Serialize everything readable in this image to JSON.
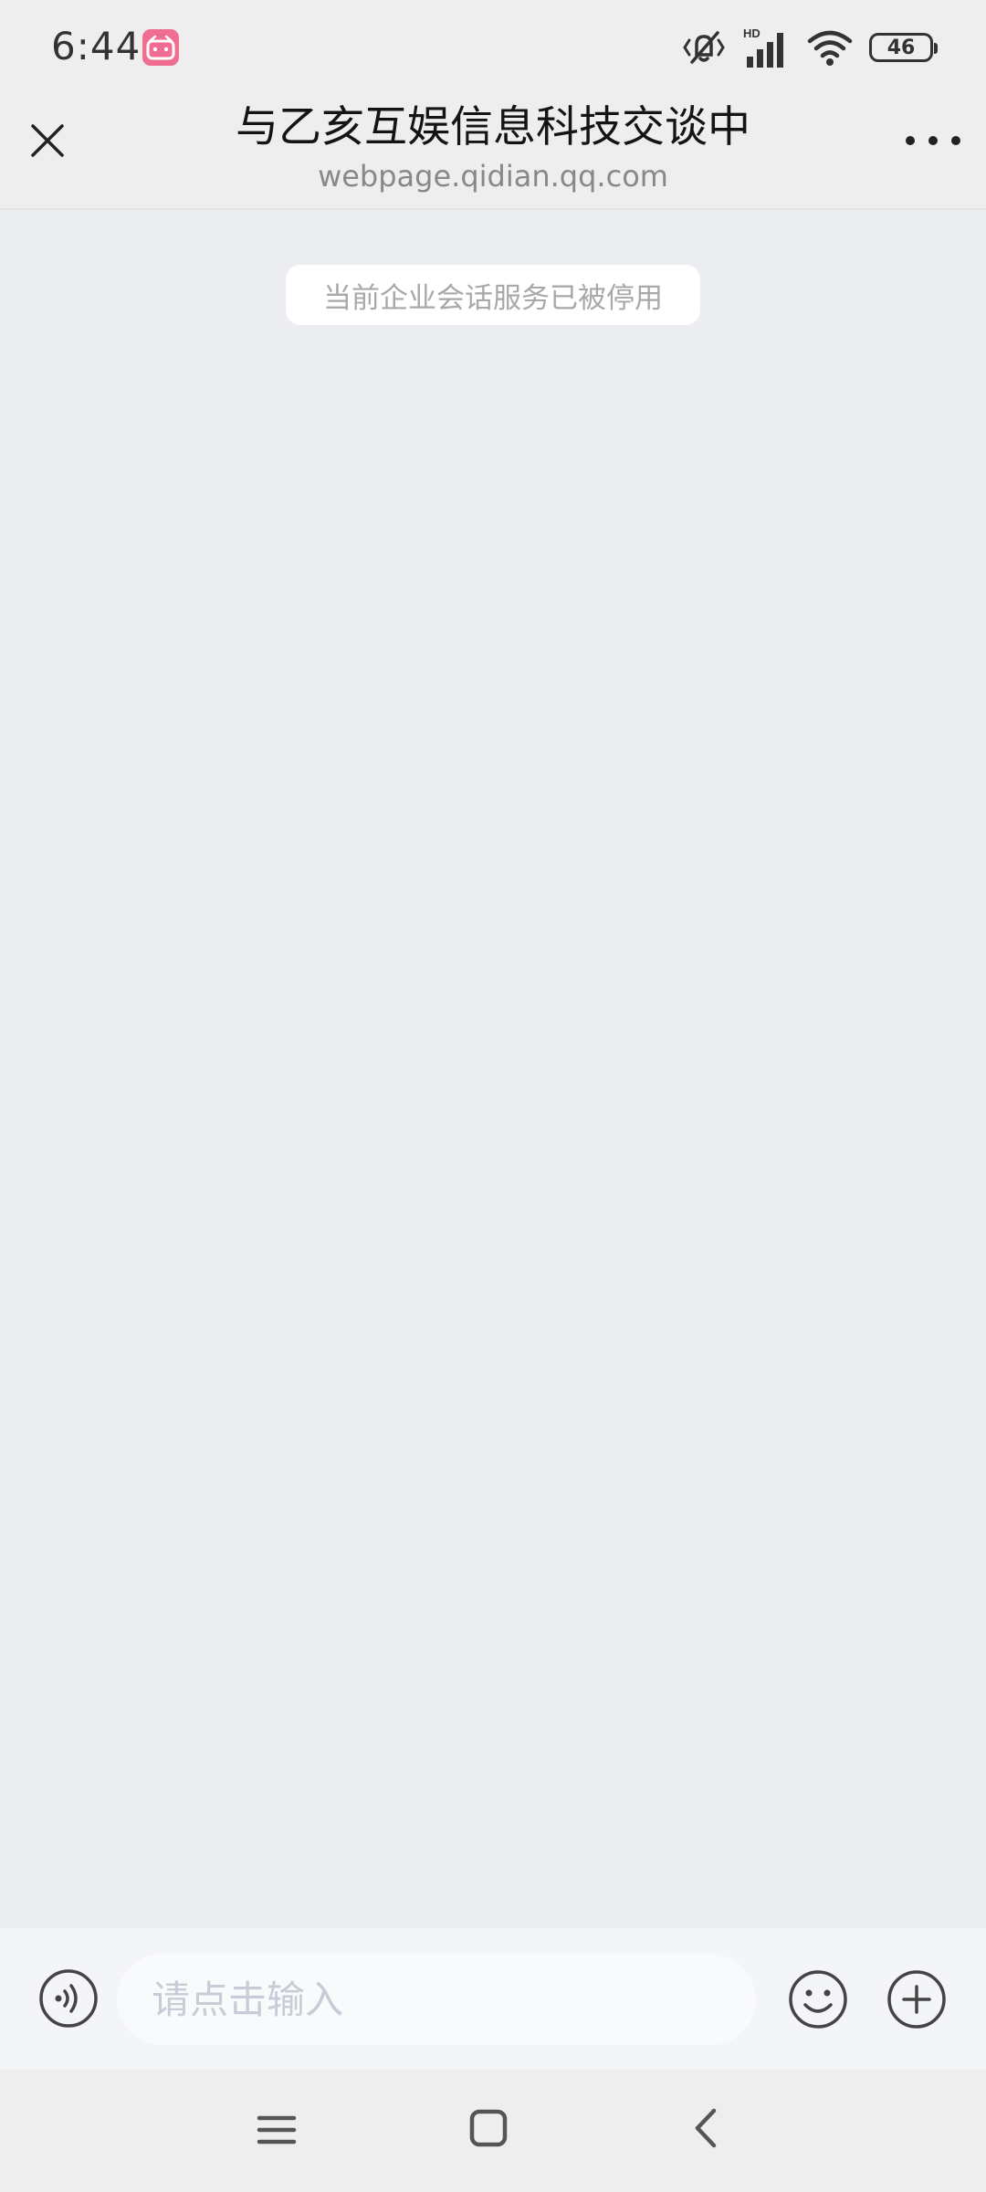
{
  "status_bar": {
    "time": "6:44",
    "network_label": "HD",
    "battery_level": "46",
    "icons": [
      "bilibili-app-icon",
      "vibrate-mute-icon",
      "signal-icon",
      "wifi-icon",
      "battery-icon"
    ]
  },
  "header": {
    "title": "与乙亥互娱信息科技交谈中",
    "url": "webpage.qidian.qq.com",
    "close_icon": "close-icon",
    "more_icon": "more-icon"
  },
  "chat": {
    "system_notice": "当前企业会话服务已被停用"
  },
  "composer": {
    "placeholder": "请点击输入",
    "voice_icon": "voice-icon",
    "emoji_icon": "emoji-icon",
    "plus_icon": "plus-icon"
  },
  "nav": {
    "icons": [
      "menu-icon",
      "home-icon",
      "back-icon"
    ]
  }
}
